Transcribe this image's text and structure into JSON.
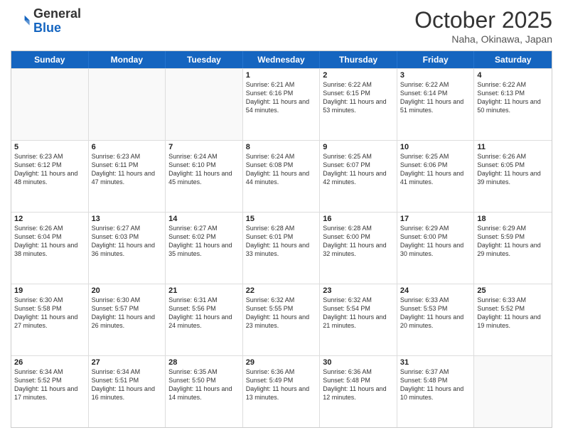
{
  "header": {
    "logo_general": "General",
    "logo_blue": "Blue",
    "month_title": "October 2025",
    "subtitle": "Naha, Okinawa, Japan"
  },
  "days_of_week": [
    "Sunday",
    "Monday",
    "Tuesday",
    "Wednesday",
    "Thursday",
    "Friday",
    "Saturday"
  ],
  "weeks": [
    [
      {
        "day": "",
        "empty": true
      },
      {
        "day": "",
        "empty": true
      },
      {
        "day": "",
        "empty": true
      },
      {
        "day": "1",
        "sunrise": "6:21 AM",
        "sunset": "6:16 PM",
        "daylight": "11 hours and 54 minutes."
      },
      {
        "day": "2",
        "sunrise": "6:22 AM",
        "sunset": "6:15 PM",
        "daylight": "11 hours and 53 minutes."
      },
      {
        "day": "3",
        "sunrise": "6:22 AM",
        "sunset": "6:14 PM",
        "daylight": "11 hours and 51 minutes."
      },
      {
        "day": "4",
        "sunrise": "6:22 AM",
        "sunset": "6:13 PM",
        "daylight": "11 hours and 50 minutes."
      }
    ],
    [
      {
        "day": "5",
        "sunrise": "6:23 AM",
        "sunset": "6:12 PM",
        "daylight": "11 hours and 48 minutes."
      },
      {
        "day": "6",
        "sunrise": "6:23 AM",
        "sunset": "6:11 PM",
        "daylight": "11 hours and 47 minutes."
      },
      {
        "day": "7",
        "sunrise": "6:24 AM",
        "sunset": "6:10 PM",
        "daylight": "11 hours and 45 minutes."
      },
      {
        "day": "8",
        "sunrise": "6:24 AM",
        "sunset": "6:08 PM",
        "daylight": "11 hours and 44 minutes."
      },
      {
        "day": "9",
        "sunrise": "6:25 AM",
        "sunset": "6:07 PM",
        "daylight": "11 hours and 42 minutes."
      },
      {
        "day": "10",
        "sunrise": "6:25 AM",
        "sunset": "6:06 PM",
        "daylight": "11 hours and 41 minutes."
      },
      {
        "day": "11",
        "sunrise": "6:26 AM",
        "sunset": "6:05 PM",
        "daylight": "11 hours and 39 minutes."
      }
    ],
    [
      {
        "day": "12",
        "sunrise": "6:26 AM",
        "sunset": "6:04 PM",
        "daylight": "11 hours and 38 minutes."
      },
      {
        "day": "13",
        "sunrise": "6:27 AM",
        "sunset": "6:03 PM",
        "daylight": "11 hours and 36 minutes."
      },
      {
        "day": "14",
        "sunrise": "6:27 AM",
        "sunset": "6:02 PM",
        "daylight": "11 hours and 35 minutes."
      },
      {
        "day": "15",
        "sunrise": "6:28 AM",
        "sunset": "6:01 PM",
        "daylight": "11 hours and 33 minutes."
      },
      {
        "day": "16",
        "sunrise": "6:28 AM",
        "sunset": "6:00 PM",
        "daylight": "11 hours and 32 minutes."
      },
      {
        "day": "17",
        "sunrise": "6:29 AM",
        "sunset": "6:00 PM",
        "daylight": "11 hours and 30 minutes."
      },
      {
        "day": "18",
        "sunrise": "6:29 AM",
        "sunset": "5:59 PM",
        "daylight": "11 hours and 29 minutes."
      }
    ],
    [
      {
        "day": "19",
        "sunrise": "6:30 AM",
        "sunset": "5:58 PM",
        "daylight": "11 hours and 27 minutes."
      },
      {
        "day": "20",
        "sunrise": "6:30 AM",
        "sunset": "5:57 PM",
        "daylight": "11 hours and 26 minutes."
      },
      {
        "day": "21",
        "sunrise": "6:31 AM",
        "sunset": "5:56 PM",
        "daylight": "11 hours and 24 minutes."
      },
      {
        "day": "22",
        "sunrise": "6:32 AM",
        "sunset": "5:55 PM",
        "daylight": "11 hours and 23 minutes."
      },
      {
        "day": "23",
        "sunrise": "6:32 AM",
        "sunset": "5:54 PM",
        "daylight": "11 hours and 21 minutes."
      },
      {
        "day": "24",
        "sunrise": "6:33 AM",
        "sunset": "5:53 PM",
        "daylight": "11 hours and 20 minutes."
      },
      {
        "day": "25",
        "sunrise": "6:33 AM",
        "sunset": "5:52 PM",
        "daylight": "11 hours and 19 minutes."
      }
    ],
    [
      {
        "day": "26",
        "sunrise": "6:34 AM",
        "sunset": "5:52 PM",
        "daylight": "11 hours and 17 minutes."
      },
      {
        "day": "27",
        "sunrise": "6:34 AM",
        "sunset": "5:51 PM",
        "daylight": "11 hours and 16 minutes."
      },
      {
        "day": "28",
        "sunrise": "6:35 AM",
        "sunset": "5:50 PM",
        "daylight": "11 hours and 14 minutes."
      },
      {
        "day": "29",
        "sunrise": "6:36 AM",
        "sunset": "5:49 PM",
        "daylight": "11 hours and 13 minutes."
      },
      {
        "day": "30",
        "sunrise": "6:36 AM",
        "sunset": "5:48 PM",
        "daylight": "11 hours and 12 minutes."
      },
      {
        "day": "31",
        "sunrise": "6:37 AM",
        "sunset": "5:48 PM",
        "daylight": "11 hours and 10 minutes."
      },
      {
        "day": "",
        "empty": true
      }
    ]
  ]
}
